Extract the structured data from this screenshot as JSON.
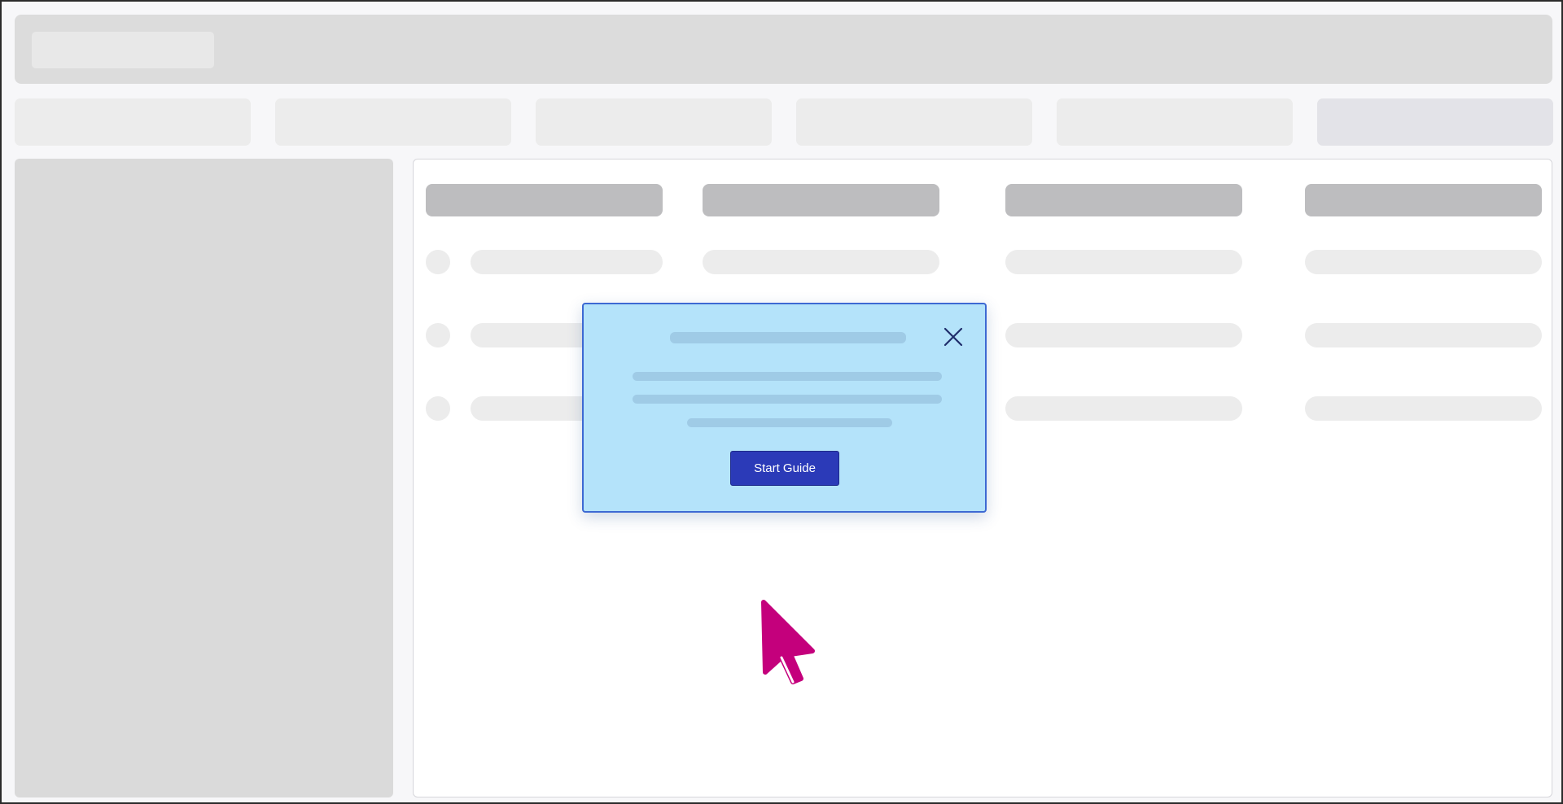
{
  "modal": {
    "start_button_label": "Start Guide",
    "close_icon": "close-icon"
  },
  "cursor": {
    "icon": "pointer-cursor-icon",
    "color": "#c4007c"
  },
  "colors": {
    "modal_background": "#b4e3fa",
    "modal_border": "#3d69d3",
    "primary_button": "#2b3ab8",
    "placeholder_dark": "#bdbdbf",
    "placeholder_light": "#ececec"
  }
}
